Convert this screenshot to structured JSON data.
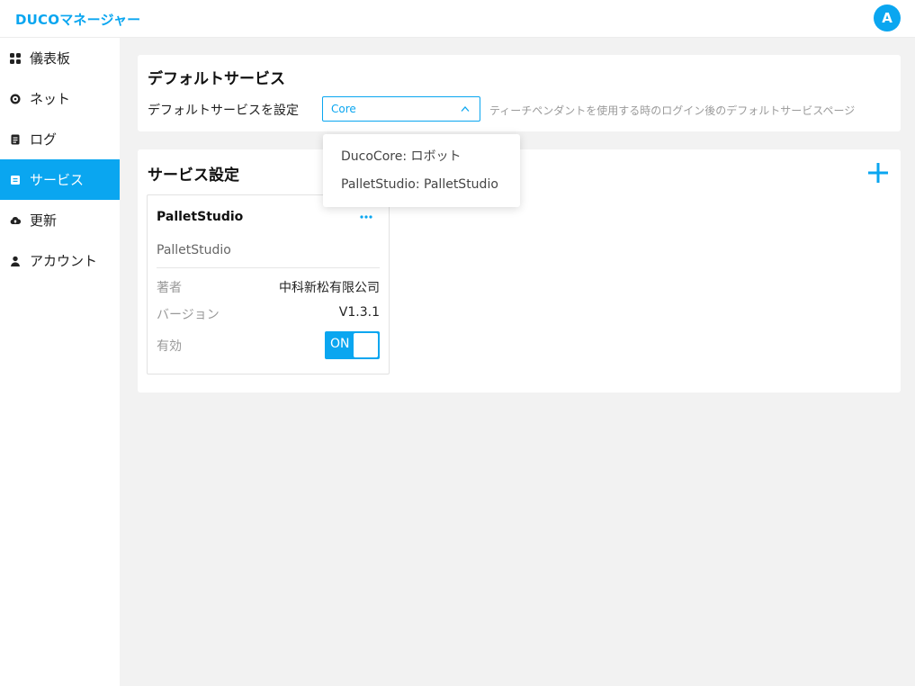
{
  "app": {
    "title": "DUCOマネージャー",
    "user_initial": "A"
  },
  "colors": {
    "accent": "#0aa6f0",
    "background": "#f2f2f2"
  },
  "sidebar": {
    "items": [
      {
        "label": "儀表板",
        "icon": "dashboard-icon",
        "active": false
      },
      {
        "label": "ネット",
        "icon": "network-icon",
        "active": false
      },
      {
        "label": "ログ",
        "icon": "log-icon",
        "active": false
      },
      {
        "label": "サービス",
        "icon": "service-icon",
        "active": true
      },
      {
        "label": "更新",
        "icon": "cloud-update-icon",
        "active": false
      },
      {
        "label": "アカウント",
        "icon": "account-icon",
        "active": false
      }
    ]
  },
  "default_service": {
    "title": "デフォルトサービス",
    "label": "デフォルトサービスを設定",
    "selected": "Core",
    "hint": "ティーチペンダントを使用する時のログイン後のデフォルトサービスページ",
    "options": [
      "DucoCore: ロボット",
      "PalletStudio: PalletStudio"
    ]
  },
  "service_settings": {
    "title": "サービス設定",
    "add_icon": "plus-icon",
    "services": [
      {
        "name": "PalletStudio",
        "description": "PalletStudio",
        "author_label": "著者",
        "author": "中科新松有限公司",
        "version_label": "バージョン",
        "version": "V1.3.1",
        "enabled_label": "有効",
        "enabled": true,
        "toggle_label": "ON"
      }
    ]
  }
}
